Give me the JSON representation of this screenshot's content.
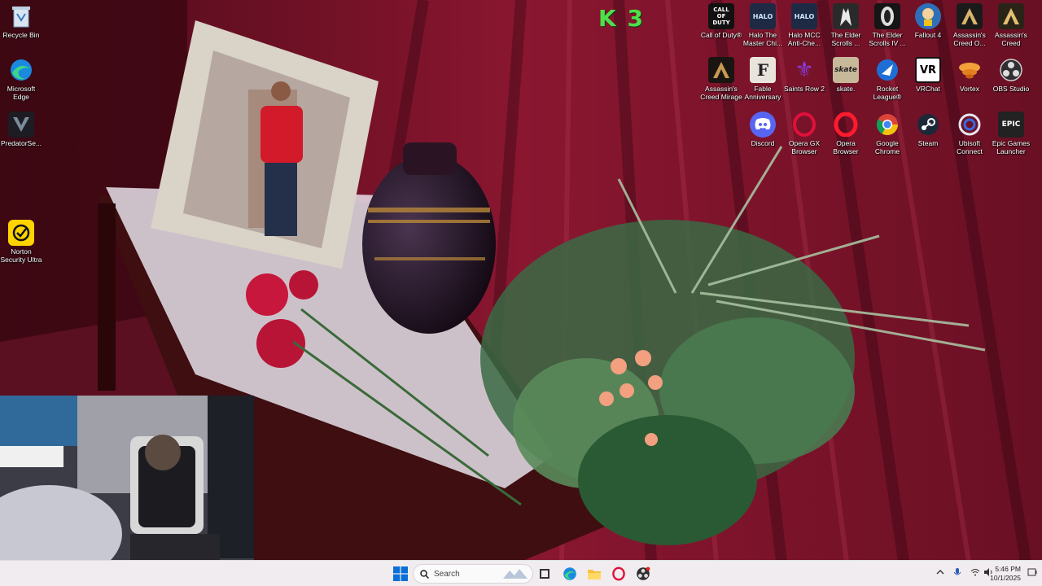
{
  "desktop": {
    "left_icons": [
      {
        "label": "Recycle Bin",
        "icon": "recycle-bin-icon"
      },
      {
        "label": "Microsoft Edge",
        "icon": "edge-icon"
      },
      {
        "label": "PredatorSe...",
        "icon": "predator-sense-icon"
      },
      {
        "label": "Norton Security Ultra",
        "icon": "norton-icon"
      }
    ],
    "right_icons_row1": [
      {
        "label": "Call of Duty®",
        "icon": "call-of-duty-icon",
        "tile_text": "CALL OF DUTY"
      },
      {
        "label": "Halo The Master Chi...",
        "icon": "halo-mcc-icon",
        "tile_text": "HALO"
      },
      {
        "label": "Halo MCC Anti-Che...",
        "icon": "halo-anticheat-icon",
        "tile_text": "HALO"
      },
      {
        "label": "The Elder Scrolls ...",
        "icon": "elder-scrolls-icon",
        "tile_text": ""
      },
      {
        "label": "The Elder Scrolls IV ...",
        "icon": "oblivion-icon",
        "tile_text": ""
      },
      {
        "label": "Fallout 4",
        "icon": "fallout-4-icon",
        "tile_text": ""
      },
      {
        "label": "Assassin's Creed O...",
        "icon": "assassins-creed-odyssey-icon",
        "tile_text": ""
      },
      {
        "label": "Assassin's Creed Origins",
        "icon": "assassins-creed-origins-icon",
        "tile_text": ""
      }
    ],
    "right_icons_row2": [
      {
        "label": "Assassin's Creed Mirage",
        "icon": "assassins-creed-mirage-icon",
        "tile_text": ""
      },
      {
        "label": "Fable Anniversary",
        "icon": "fable-icon",
        "tile_text": "F"
      },
      {
        "label": "Saints Row 2",
        "icon": "saints-row-icon",
        "tile_text": "⚜"
      },
      {
        "label": "skate.",
        "icon": "skate-icon",
        "tile_text": "skate"
      },
      {
        "label": "Rocket League®",
        "icon": "rocket-league-icon",
        "tile_text": ""
      },
      {
        "label": "VRChat",
        "icon": "vrchat-icon",
        "tile_text": "VR"
      },
      {
        "label": "Vortex",
        "icon": "vortex-icon",
        "tile_text": ""
      },
      {
        "label": "OBS Studio",
        "icon": "obs-studio-icon",
        "tile_text": ""
      }
    ],
    "right_icons_row3": [
      {
        "label": "Discord",
        "icon": "discord-icon",
        "tile_text": ""
      },
      {
        "label": "Opera GX Browser",
        "icon": "opera-gx-icon",
        "tile_text": "O"
      },
      {
        "label": "Opera Browser",
        "icon": "opera-icon",
        "tile_text": "O"
      },
      {
        "label": "Google Chrome",
        "icon": "chrome-icon",
        "tile_text": ""
      },
      {
        "label": "Steam",
        "icon": "steam-icon",
        "tile_text": ""
      },
      {
        "label": "Ubisoft Connect",
        "icon": "ubisoft-connect-icon",
        "tile_text": ""
      },
      {
        "label": "Epic Games Launcher",
        "icon": "epic-games-icon",
        "tile_text": "EPIC"
      }
    ],
    "overlay_logo": "K 3"
  },
  "taskbar": {
    "search_placeholder": "Search",
    "pinned": [
      {
        "icon": "start-icon"
      },
      {
        "icon": "task-view-icon"
      },
      {
        "icon": "edge-icon"
      },
      {
        "icon": "file-explorer-icon"
      },
      {
        "icon": "opera-gx-icon"
      },
      {
        "icon": "obs-studio-icon"
      }
    ],
    "tray_icons": [
      "chevron-up-icon",
      "microphone-icon",
      "wifi-icon",
      "speaker-icon",
      "battery-icon"
    ],
    "time": "5:46 PM",
    "date": "10/1/2025"
  },
  "colors": {
    "wallpaper_curtain": "#7a1228",
    "taskbar_bg": "#f1ecef",
    "start_blue": "#0a6fd8"
  }
}
